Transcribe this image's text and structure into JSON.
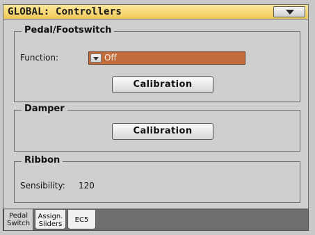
{
  "title": "GLOBAL: Controllers",
  "pedal_group": {
    "title": "Pedal/Footswitch",
    "function_label": "Function:",
    "function_value": "Off",
    "calibration_label": "Calibration"
  },
  "damper_group": {
    "title": "Damper",
    "calibration_label": "Calibration"
  },
  "ribbon_group": {
    "title": "Ribbon",
    "sensibility_label": "Sensibility:",
    "sensibility_value": "120"
  },
  "tabs": [
    {
      "line1": "Pedal",
      "line2": "Switch",
      "active": true
    },
    {
      "line1": "Assign.",
      "line2": "Sliders",
      "active": false
    },
    {
      "line1": "EC5",
      "line2": "",
      "active": false
    }
  ],
  "colors": {
    "title_bar": "#f1c95a",
    "panel": "#cfcfcf",
    "dropdown": "#c16a3a",
    "tab_strip": "#6e6e6e"
  }
}
